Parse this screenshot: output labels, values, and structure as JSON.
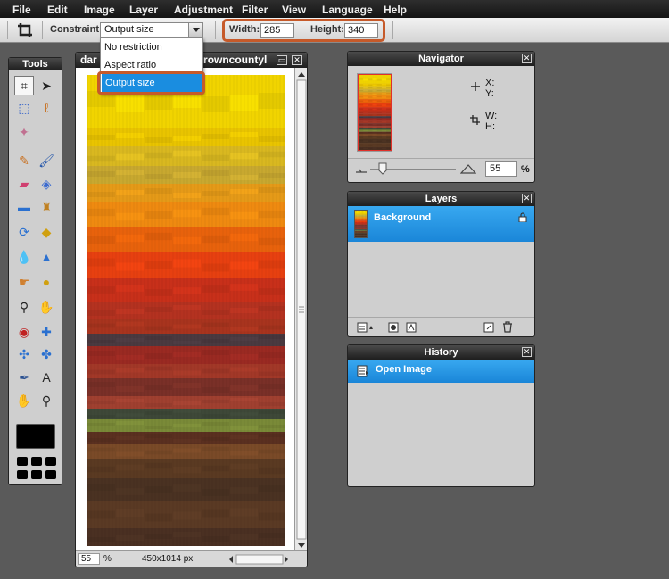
{
  "menubar": {
    "items": [
      "File",
      "Edit",
      "Image",
      "Layer",
      "Adjustment",
      "Filter",
      "View",
      "Language",
      "Help"
    ]
  },
  "toolbar": {
    "constraint_label": "Constraint:",
    "constraint_value": "Output size",
    "width_label": "Width:",
    "width_value": "285",
    "height_label": "Height:",
    "height_value": "340"
  },
  "constraint_dropdown": {
    "options": [
      "No restriction",
      "Aspect ratio",
      "Output size"
    ],
    "selected_index": 2
  },
  "tools_panel": {
    "title": "Tools",
    "tools": [
      "crop-icon",
      "move-icon",
      "marquee-icon",
      "lasso-icon",
      "magic-wand-icon",
      "pencil-icon",
      "brush-icon",
      "eraser-icon",
      "paint-bucket-icon",
      "gradient-icon",
      "clone-stamp-icon",
      "color-replace-icon",
      "shape-icon",
      "drop-icon",
      "sharpen-icon",
      "smudge-icon",
      "sponge-icon",
      "dodge-icon",
      "burn-icon",
      "red-eye-icon",
      "spot-heal-icon",
      "bloat-icon",
      "pinch-icon",
      "color-picker-icon",
      "type-icon",
      "hand-icon",
      "zoom-icon"
    ],
    "foreground_color": "#000000"
  },
  "image_window": {
    "title": "dar",
    "title_tail": "browncountyl",
    "zoom": "55",
    "zoom_unit": "%",
    "dimensions": "450x1014 px"
  },
  "navigator": {
    "title": "Navigator",
    "x_label": "X:",
    "y_label": "Y:",
    "w_label": "W:",
    "h_label": "H:",
    "zoom": "55",
    "zoom_unit": "%"
  },
  "layers": {
    "title": "Layers",
    "items": [
      {
        "name": "Background",
        "locked": true
      }
    ]
  },
  "history": {
    "title": "History",
    "items": [
      {
        "name": "Open Image"
      }
    ]
  },
  "colors": {
    "highlight": "#c65a2a",
    "selection": "#1a86d8",
    "panel_bg": "#cfcfcf",
    "workspace": "#5a5a5a"
  }
}
